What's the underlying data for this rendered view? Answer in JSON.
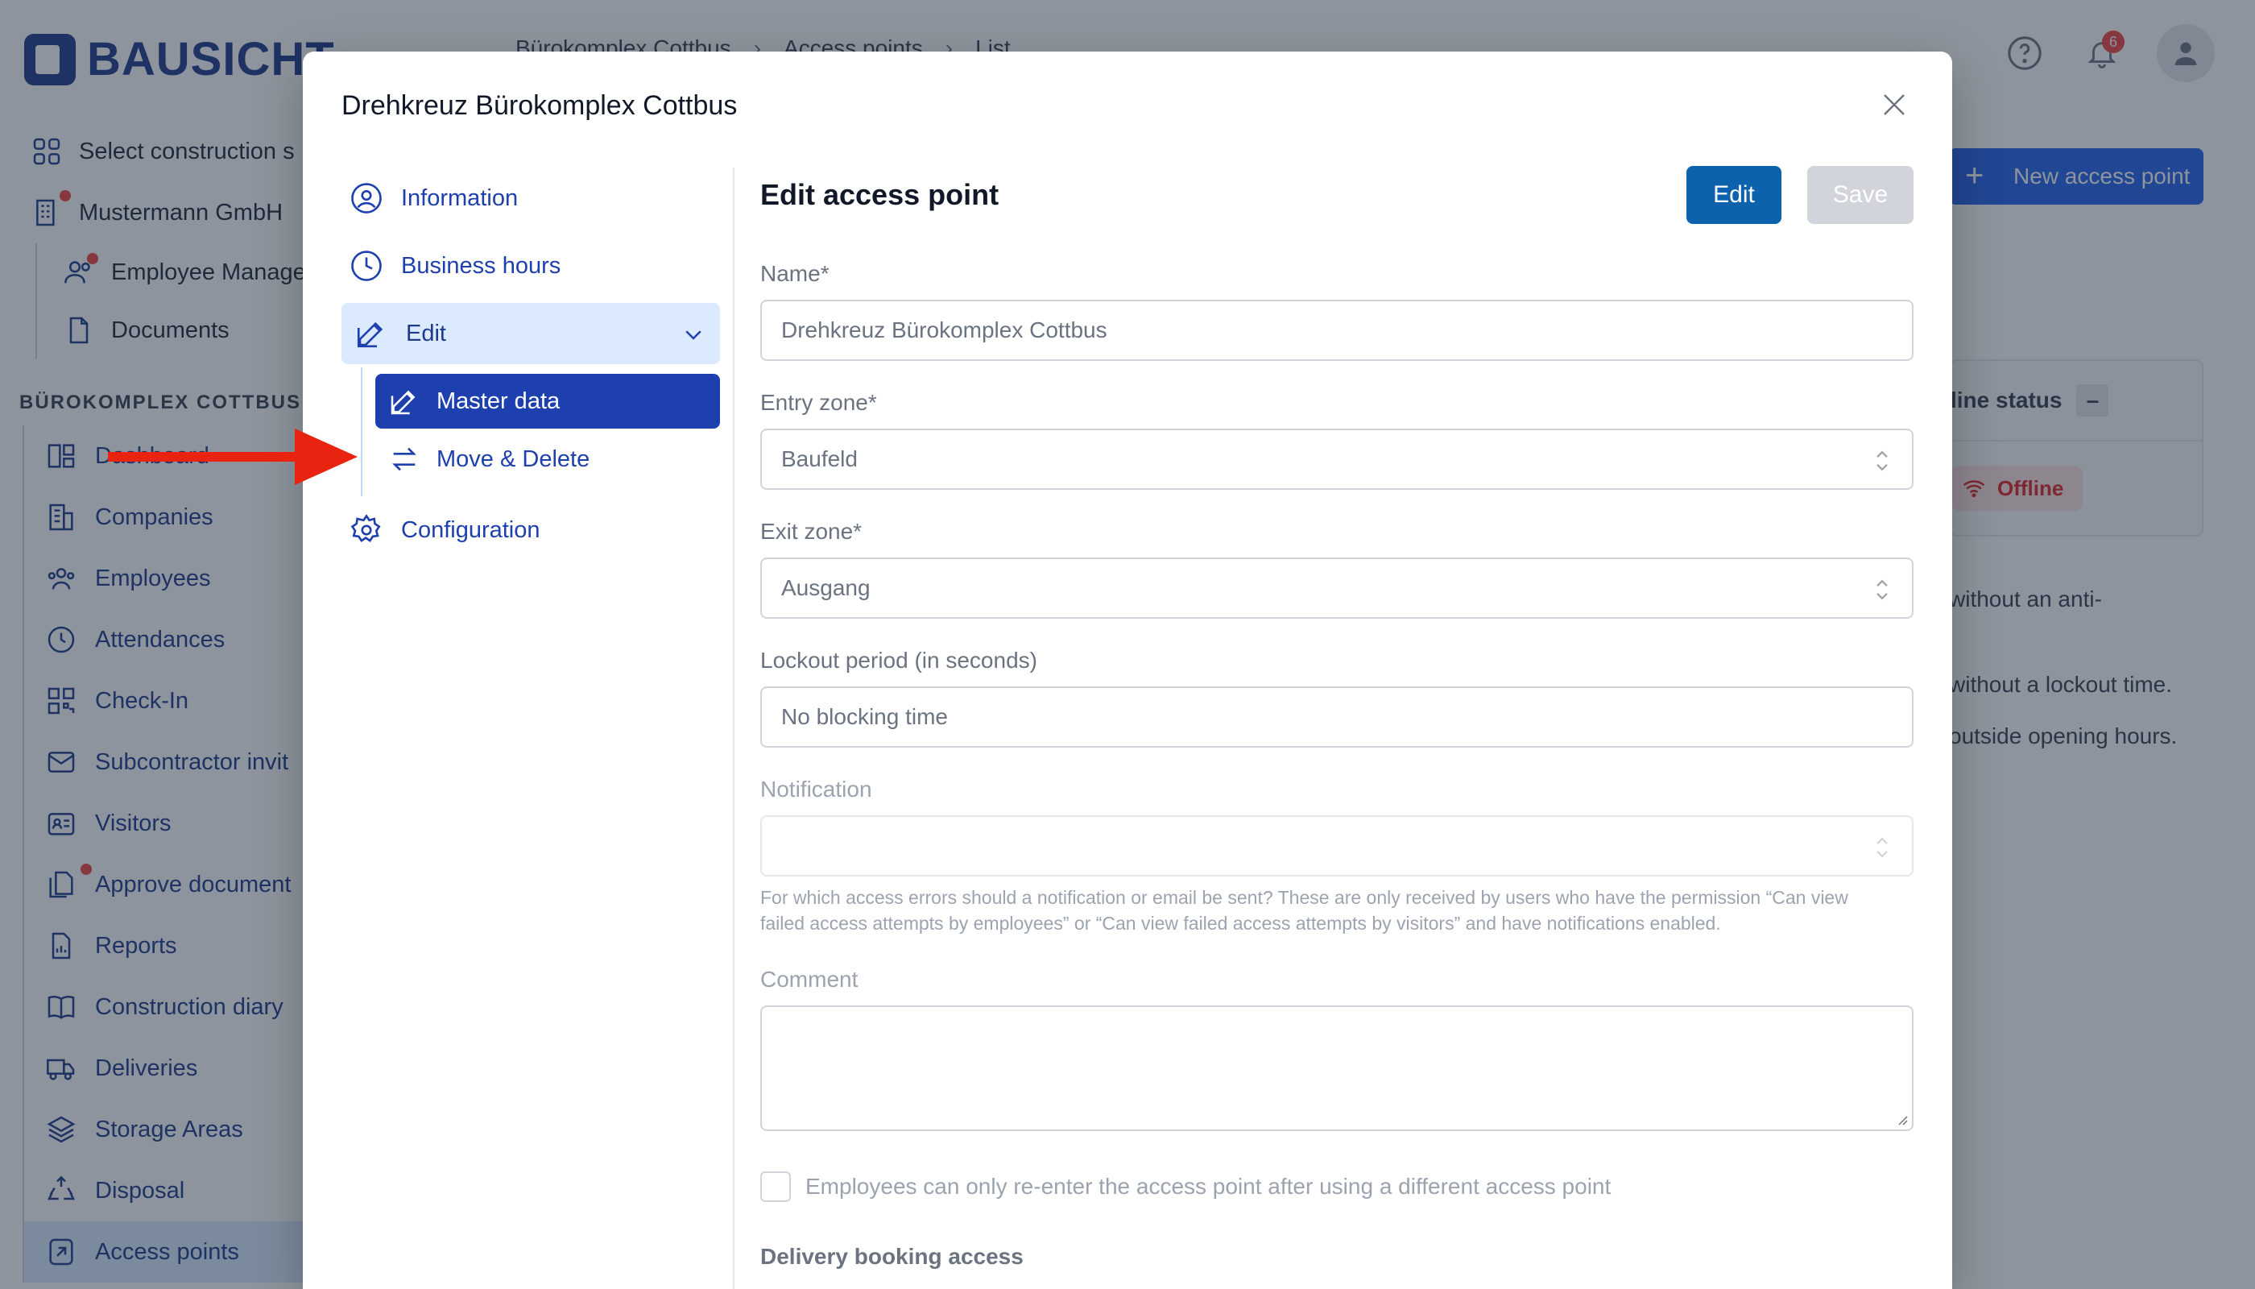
{
  "app": {
    "logo_text": "BAUSICHT",
    "breadcrumb": [
      "Bürokomplex Cottbus",
      "Access points",
      "List"
    ],
    "notification_count": "6",
    "sidebar_top": [
      {
        "label": "Select construction s",
        "icon": "grid-icon"
      },
      {
        "label": "Mustermann GmbH",
        "icon": "building-icon"
      }
    ],
    "sidebar_sub": [
      {
        "label": "Employee Manage",
        "icon": "users-icon"
      },
      {
        "label": "Documents",
        "icon": "document-icon"
      }
    ],
    "section_title": "BÜROKOMPLEX COTTBUS",
    "sidebar_items": [
      {
        "label": "Dashboard",
        "icon": "dashboard-icon"
      },
      {
        "label": "Companies",
        "icon": "companies-icon"
      },
      {
        "label": "Employees",
        "icon": "employees-icon"
      },
      {
        "label": "Attendances",
        "icon": "clock-icon"
      },
      {
        "label": "Check-In",
        "icon": "qr-icon"
      },
      {
        "label": "Subcontractor invit",
        "icon": "mail-icon"
      },
      {
        "label": "Visitors",
        "icon": "visitor-icon"
      },
      {
        "label": "Approve document",
        "icon": "approve-icon"
      },
      {
        "label": "Reports",
        "icon": "report-icon"
      },
      {
        "label": "Construction diary",
        "icon": "book-icon"
      },
      {
        "label": "Deliveries",
        "icon": "truck-icon"
      },
      {
        "label": "Storage Areas",
        "icon": "layers-icon"
      },
      {
        "label": "Disposal",
        "icon": "recycle-icon"
      },
      {
        "label": "Access points",
        "icon": "access-icon"
      }
    ],
    "new_button": "New access point",
    "status_header": "line status",
    "status_minus": "–",
    "offline": "Offline",
    "notes": [
      "without an anti-",
      "without a lockout time.",
      "outside opening hours."
    ]
  },
  "modal": {
    "title": "Drehkreuz Bürokomplex Cottbus",
    "nav": {
      "information": "Information",
      "business_hours": "Business hours",
      "edit": "Edit",
      "master_data": "Master data",
      "move_delete": "Move & Delete",
      "configuration": "Configuration"
    },
    "form": {
      "title": "Edit access point",
      "edit_button": "Edit",
      "save_button": "Save",
      "name_label": "Name*",
      "name_value": "Drehkreuz Bürokomplex Cottbus",
      "entry_zone_label": "Entry zone*",
      "entry_zone_value": "Baufeld",
      "exit_zone_label": "Exit zone*",
      "exit_zone_value": "Ausgang",
      "lockout_label": "Lockout period (in seconds)",
      "lockout_placeholder": "No blocking time",
      "notification_label": "Notification",
      "notification_value": "",
      "notification_hint": "For which access errors should a notification or email be sent? These are only received by users who have the permission “Can view failed access attempts by employees” or “Can view failed access attempts by visitors” and have notifications enabled.",
      "comment_label": "Comment",
      "comment_value": "",
      "reenter_label": "Employees can only re-enter the access point after using a different access point",
      "delivery_label": "Delivery booking access"
    }
  },
  "colors": {
    "primary": "#1e40af",
    "edit_button": "#0e62ad",
    "annotation_arrow": "#e8230f",
    "offline_red": "#dc2626"
  }
}
